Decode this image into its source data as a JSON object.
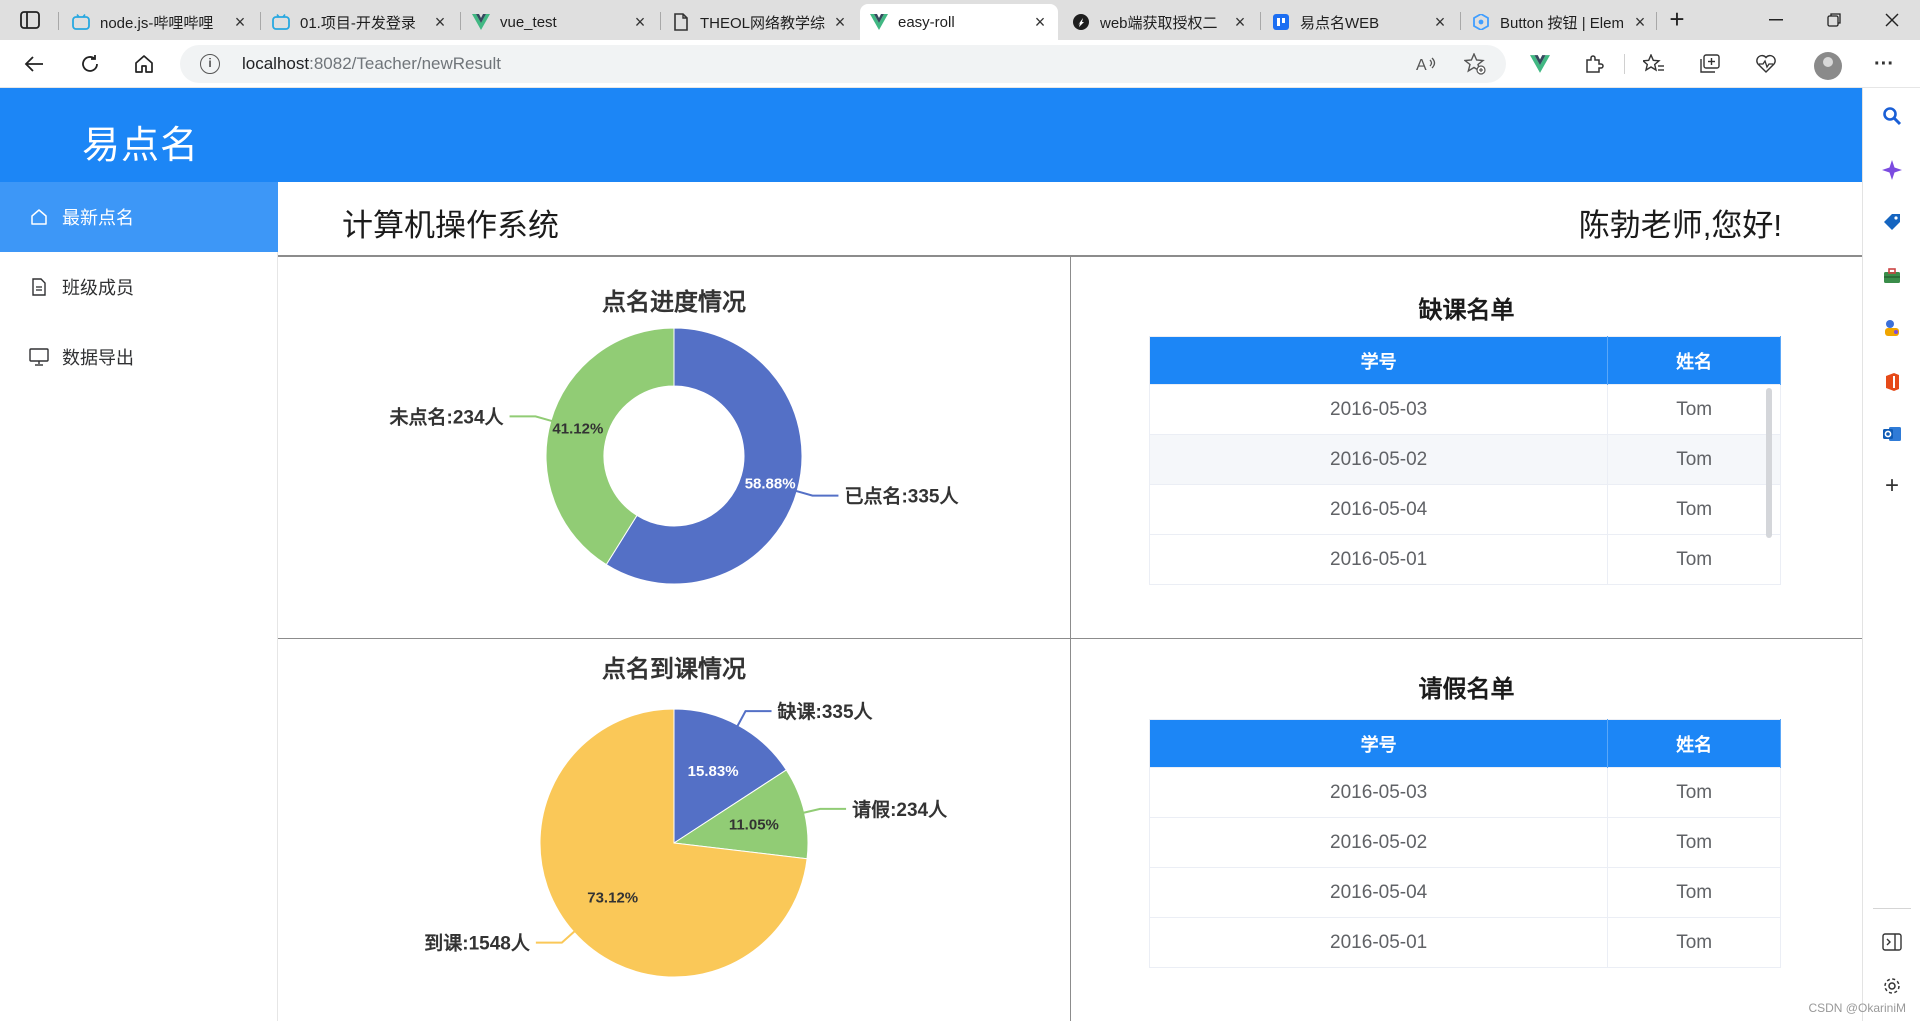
{
  "browser": {
    "tabs": [
      {
        "title": "node.js-哔哩哔哩",
        "icon": "bilibili-icon"
      },
      {
        "title": "01.项目-开发登录",
        "icon": "bilibili-icon"
      },
      {
        "title": "vue_test",
        "icon": "vue-icon"
      },
      {
        "title": "THEOL网络教学综",
        "icon": "document-icon"
      },
      {
        "title": "easy-roll",
        "icon": "vue-icon",
        "active": true
      },
      {
        "title": "web端获取授权二",
        "icon": "juejin-icon"
      },
      {
        "title": "易点名WEB",
        "icon": "app-icon"
      },
      {
        "title": "Button 按钮 | Elem",
        "icon": "element-icon"
      }
    ],
    "url_host": "localhost",
    "url_path": ":8082/Teacher/newResult"
  },
  "app": {
    "title": "易点名",
    "menu": [
      {
        "label": "最新点名",
        "icon": "home-icon",
        "active": true
      },
      {
        "label": "班级成员",
        "icon": "document-icon"
      },
      {
        "label": "数据导出",
        "icon": "monitor-icon"
      }
    ],
    "course_name": "计算机操作系统",
    "greeting": "陈勃老师,您好!"
  },
  "charts": {
    "progress": {
      "title": "点名进度情况",
      "labels": [
        "已点名:335人",
        "未点名:234人"
      ],
      "percents": [
        "58.88%",
        "41.12%"
      ]
    },
    "attendance": {
      "title": "点名到课情况",
      "labels": [
        "缺课:335人",
        "请假:234人",
        "到课:1548人"
      ],
      "percents": [
        "15.83%",
        "11.05%",
        "73.12%"
      ]
    }
  },
  "chart_data": [
    {
      "type": "pie",
      "title": "点名进度情况",
      "donut": true,
      "categories": [
        "已点名",
        "未点名"
      ],
      "values": [
        335,
        234
      ],
      "colors": [
        "#5470c6",
        "#91cc75"
      ]
    },
    {
      "type": "pie",
      "title": "点名到课情况",
      "donut": false,
      "categories": [
        "缺课",
        "请假",
        "到课"
      ],
      "values": [
        335,
        234,
        1548
      ],
      "colors": [
        "#5470c6",
        "#91cc75",
        "#fac858"
      ]
    }
  ],
  "tables": {
    "absent": {
      "title": "缺课名单",
      "headers": [
        "学号",
        "姓名"
      ],
      "rows": [
        [
          "2016-05-03",
          "Tom"
        ],
        [
          "2016-05-02",
          "Tom"
        ],
        [
          "2016-05-04",
          "Tom"
        ],
        [
          "2016-05-01",
          "Tom"
        ]
      ]
    },
    "leave": {
      "title": "请假名单",
      "headers": [
        "学号",
        "姓名"
      ],
      "rows": [
        [
          "2016-05-03",
          "Tom"
        ],
        [
          "2016-05-02",
          "Tom"
        ],
        [
          "2016-05-04",
          "Tom"
        ],
        [
          "2016-05-01",
          "Tom"
        ]
      ]
    }
  },
  "watermark": "CSDN @OkariniM"
}
